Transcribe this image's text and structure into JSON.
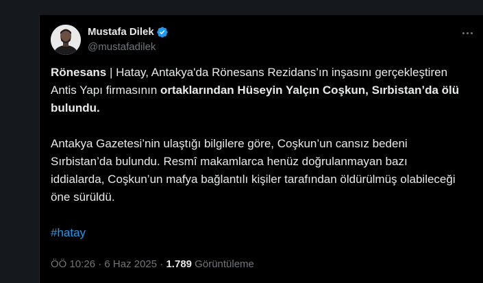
{
  "author": {
    "display_name": "Mustafa Dilek",
    "handle": "@mustafadilek",
    "verified_badge_color": "#1d9bf0"
  },
  "tweet": {
    "paragraph1": {
      "lead_bold": "Rönesans",
      "middle": " | Hatay, Antakya'da Rönesans Rezidans’ın inşasını gerçekleştiren Antis Yapı firmasının ",
      "tail_bold": "ortaklarından Hüseyin Yalçın Coşkun, Sırbistan’da ölü bulundu."
    },
    "paragraph2": "Antakya Gazetesi’nin ulaştığı bilgilere göre, Coşkun’un cansız bedeni Sırbistan’da bulundu. Resmî makamlarca henüz doğrulanmayan bazı iddialarda, Coşkun’un mafya bağlantılı kişiler tarafından öldürülmüş olabileceği öne sürüldü.",
    "hashtag": "#hatay"
  },
  "meta": {
    "time": "ÖÖ 10:26",
    "separator": " · ",
    "date": "6 Haz 2025",
    "views_count": "1.789",
    "views_label": " Görüntüleme"
  },
  "icons": {
    "more": "more-options-icon",
    "verified": "verified-badge-icon"
  },
  "colors": {
    "background": "#000000",
    "text": "#e7e9ea",
    "secondary_text": "#71767b",
    "link": "#1d9bf0"
  }
}
